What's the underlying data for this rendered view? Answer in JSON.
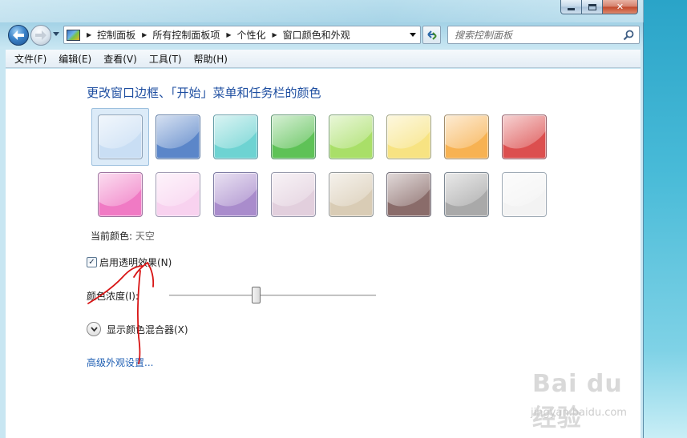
{
  "window": {
    "caption": {
      "minimize": "minimize",
      "maximize": "maximize",
      "close": "close"
    }
  },
  "nav": {
    "breadcrumbs": [
      "控制面板",
      "所有控制面板项",
      "个性化",
      "窗口颜色和外观"
    ],
    "search_placeholder": "搜索控制面板"
  },
  "menu": [
    "文件(F)",
    "编辑(E)",
    "查看(V)",
    "工具(T)",
    "帮助(H)"
  ],
  "content": {
    "title": "更改窗口边框、「开始」菜单和任务栏的颜色",
    "current_color_label": "当前颜色:",
    "current_color_value": "天空",
    "transparency_label": "启用透明效果(N)",
    "transparency_checked": true,
    "intensity_label": "颜色浓度(I):",
    "intensity_value": 0.42,
    "mixer_label": "显示颜色混合器(X)",
    "advanced_link": "高级外观设置..."
  },
  "swatches": [
    {
      "color": "#c9def4",
      "selected": true
    },
    {
      "color": "#5b86c9"
    },
    {
      "color": "#6ed3d2"
    },
    {
      "color": "#5ec257"
    },
    {
      "color": "#a9df68"
    },
    {
      "color": "#f7e382"
    },
    {
      "color": "#f7b252"
    },
    {
      "color": "#dc4f4f"
    },
    {
      "color": "#f07ac4"
    },
    {
      "color": "#f8d2ef"
    },
    {
      "color": "#a98ccc"
    },
    {
      "color": "#e2cfdd"
    },
    {
      "color": "#d9ccb5"
    },
    {
      "color": "#8a6c6a"
    },
    {
      "color": "#a9a9a9"
    },
    {
      "color": "#f3f3f3"
    }
  ],
  "watermark": {
    "logo": "Bai du 经验",
    "url": "jingyan.baidu.com"
  }
}
